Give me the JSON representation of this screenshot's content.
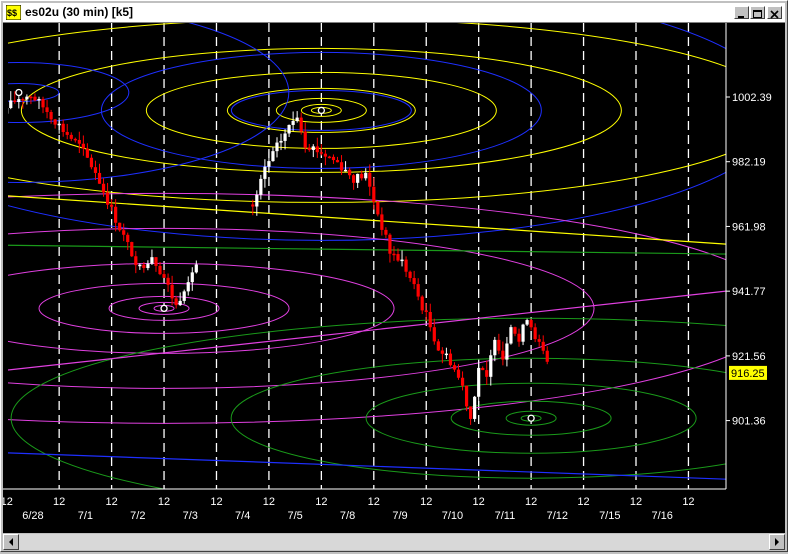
{
  "window": {
    "title": "es02u (30 min) [k5]",
    "controls": [
      "minimize",
      "maximize",
      "close"
    ]
  },
  "colors": {
    "background": "#000000",
    "up_candle": "#ffffff",
    "down_candle": "#ff0000",
    "price_badge": "#ffff00",
    "grid": "#ffffff",
    "ellipse_yellow": "#ffff00",
    "ellipse_blue": "#1e2fff",
    "ellipse_magenta": "#e040e0",
    "ellipse_green": "#1a9a1a"
  },
  "chart_data": {
    "type": "candlestick",
    "symbol": "es02u",
    "interval": "30 min",
    "y_axis": {
      "ticks": [
        1002.39,
        982.19,
        961.98,
        941.77,
        921.56,
        901.36
      ],
      "range": [
        880,
        1023
      ],
      "last_price": "916.25"
    },
    "x_axis": {
      "hour_label": "12",
      "date_labels": [
        "6/28",
        "7/1",
        "7/2",
        "7/3",
        "7/4",
        "7/5",
        "7/8",
        "7/9",
        "7/10",
        "7/11",
        "7/12",
        "7/15",
        "7/16"
      ]
    },
    "grid": "vertical dashed",
    "candles_per_day": 13,
    "close_path": [
      [
        0,
        983
      ],
      [
        3,
        992
      ],
      [
        6,
        999
      ],
      [
        9,
        1002
      ],
      [
        12,
        1003
      ],
      [
        16,
        998
      ],
      [
        20,
        992
      ],
      [
        24,
        987
      ],
      [
        28,
        979
      ],
      [
        32,
        967
      ],
      [
        36,
        956
      ],
      [
        39,
        949
      ],
      [
        42,
        953
      ],
      [
        45,
        946
      ],
      [
        48,
        937
      ],
      [
        51,
        946
      ],
      [
        54,
        952
      ],
      [
        67,
        967
      ],
      [
        70,
        980
      ],
      [
        74,
        989
      ],
      [
        78,
        997
      ],
      [
        80,
        988
      ],
      [
        84,
        985
      ],
      [
        88,
        982
      ],
      [
        92,
        977
      ],
      [
        95,
        978
      ],
      [
        98,
        966
      ],
      [
        101,
        954
      ],
      [
        104,
        951
      ],
      [
        107,
        943
      ],
      [
        110,
        934
      ],
      [
        113,
        924
      ],
      [
        116,
        920
      ],
      [
        119,
        912
      ],
      [
        121,
        902
      ],
      [
        123,
        918
      ],
      [
        125,
        914
      ],
      [
        127,
        928
      ],
      [
        129,
        921
      ],
      [
        131,
        932
      ],
      [
        133,
        926
      ],
      [
        135,
        934
      ],
      [
        137,
        928
      ],
      [
        139,
        922
      ],
      [
        141,
        916
      ]
    ],
    "markers": [
      {
        "day": 0,
        "bar": 9,
        "price": 1003.8
      },
      {
        "day": 6,
        "bar": 6,
        "price": 998.2
      },
      {
        "day": 3,
        "bar": 6,
        "price": 936.4
      },
      {
        "day": 10,
        "bar": 6,
        "price": 902.1
      }
    ],
    "ellipse_groups": [
      {
        "color": "yellow",
        "center": {
          "day": 6,
          "bar": 6,
          "price": 998.2
        },
        "rx": [
          10,
          20,
          45,
          94,
          175,
          300,
          460
        ],
        "ry": [
          3,
          6,
          12,
          22,
          38,
          62,
          92
        ]
      },
      {
        "color": "blue",
        "center": {
          "day": 6,
          "bar": 6,
          "price": 998.2
        },
        "rx": [
          90,
          220,
          460
        ],
        "ry": [
          20,
          58,
          130
        ]
      },
      {
        "color": "blue",
        "center": {
          "day": 0,
          "bar": 9,
          "price": 1003.8
        },
        "rx": [
          40,
          110,
          270
        ],
        "ry": [
          9,
          30,
          90
        ]
      },
      {
        "color": "magenta",
        "center": {
          "day": 3,
          "bar": 6,
          "price": 936.4
        },
        "rx": [
          10,
          25,
          55,
          125,
          230,
          430,
          620
        ],
        "ry": [
          3,
          6,
          12,
          25,
          45,
          80,
          115
        ]
      },
      {
        "color": "green",
        "center": {
          "day": 10,
          "bar": 6,
          "price": 902.1
        },
        "rx": [
          10,
          25,
          80,
          165,
          300,
          520
        ],
        "ry": [
          3,
          7,
          17,
          35,
          60,
          100
        ]
      }
    ],
    "horizontal_lines": [
      {
        "color": "yellow",
        "price": 965.5,
        "slope_per_day": -1.1
      },
      {
        "color": "green",
        "price": 955.0,
        "slope_per_day": -0.2
      },
      {
        "color": "magenta",
        "price": 927.0,
        "slope_per_day": 1.8
      },
      {
        "color": "blue",
        "price": 888.0,
        "slope_per_day": -0.6
      }
    ]
  }
}
